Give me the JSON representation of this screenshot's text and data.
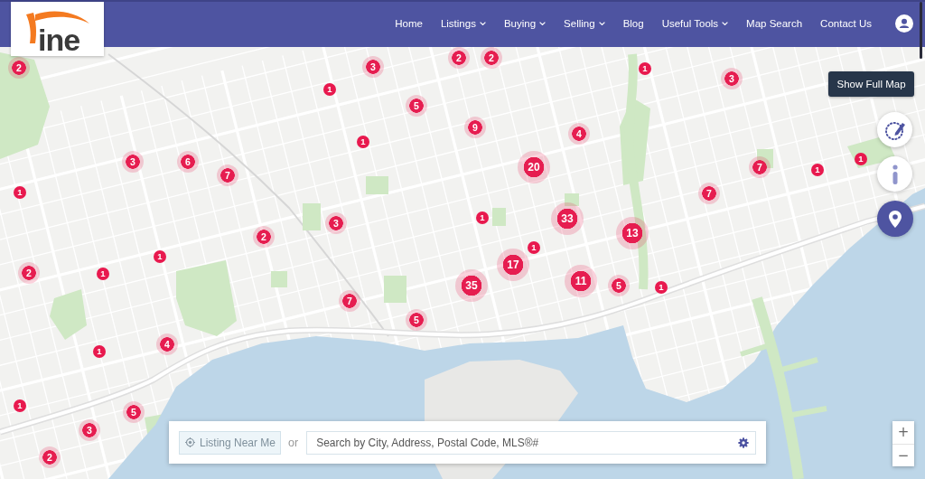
{
  "header": {
    "logo": {
      "text": "ine"
    },
    "nav": [
      {
        "label": "Home",
        "dropdown": false
      },
      {
        "label": "Listings",
        "dropdown": true
      },
      {
        "label": "Buying",
        "dropdown": true
      },
      {
        "label": "Selling",
        "dropdown": true
      },
      {
        "label": "Blog",
        "dropdown": false
      },
      {
        "label": "Useful Tools",
        "dropdown": true
      },
      {
        "label": "Map Search",
        "dropdown": false
      },
      {
        "label": "Contact Us",
        "dropdown": false
      }
    ]
  },
  "map": {
    "show_full_map": "Show Full Map",
    "markers": [
      {
        "kind": "cluster",
        "count": "2"
      },
      {
        "kind": "cluster",
        "count": "2"
      },
      {
        "kind": "cluster",
        "count": "2"
      },
      {
        "kind": "cluster",
        "count": "3"
      },
      {
        "kind": "pin",
        "count": "1"
      },
      {
        "kind": "cluster",
        "count": "3"
      },
      {
        "kind": "pin",
        "count": "1"
      },
      {
        "kind": "cluster",
        "count": "5"
      },
      {
        "kind": "cluster",
        "count": "9"
      },
      {
        "kind": "cluster",
        "count": "4"
      },
      {
        "kind": "pin",
        "count": "1"
      },
      {
        "kind": "cluster",
        "count": "3"
      },
      {
        "kind": "cluster",
        "count": "6"
      },
      {
        "kind": "cluster",
        "count": "7"
      },
      {
        "kind": "big",
        "count": "20"
      },
      {
        "kind": "cluster",
        "count": "7"
      },
      {
        "kind": "pin",
        "count": "1"
      },
      {
        "kind": "pin",
        "count": "1"
      },
      {
        "kind": "pin",
        "count": "1"
      },
      {
        "kind": "cluster",
        "count": "7"
      },
      {
        "kind": "cluster",
        "count": "3"
      },
      {
        "kind": "pin",
        "count": "1"
      },
      {
        "kind": "big",
        "count": "33"
      },
      {
        "kind": "cluster",
        "count": "2"
      },
      {
        "kind": "big",
        "count": "13"
      },
      {
        "kind": "pin",
        "count": "1"
      },
      {
        "kind": "pin",
        "count": "1"
      },
      {
        "kind": "big",
        "count": "17"
      },
      {
        "kind": "cluster",
        "count": "2"
      },
      {
        "kind": "pin",
        "count": "1"
      },
      {
        "kind": "big",
        "count": "35"
      },
      {
        "kind": "big",
        "count": "11"
      },
      {
        "kind": "cluster",
        "count": "5"
      },
      {
        "kind": "pin",
        "count": "1"
      },
      {
        "kind": "cluster",
        "count": "7"
      },
      {
        "kind": "cluster",
        "count": "5"
      },
      {
        "kind": "cluster",
        "count": "4"
      },
      {
        "kind": "pin",
        "count": "1"
      },
      {
        "kind": "pin",
        "count": "1"
      },
      {
        "kind": "cluster",
        "count": "5"
      },
      {
        "kind": "cluster",
        "count": "3"
      },
      {
        "kind": "cluster",
        "count": "2"
      }
    ],
    "zoom": {
      "in": "+",
      "out": "−"
    }
  },
  "search": {
    "near_me": "Listing Near Me",
    "separator": "or",
    "placeholder": "Search by City, Address, Postal Code, MLS®#"
  }
}
